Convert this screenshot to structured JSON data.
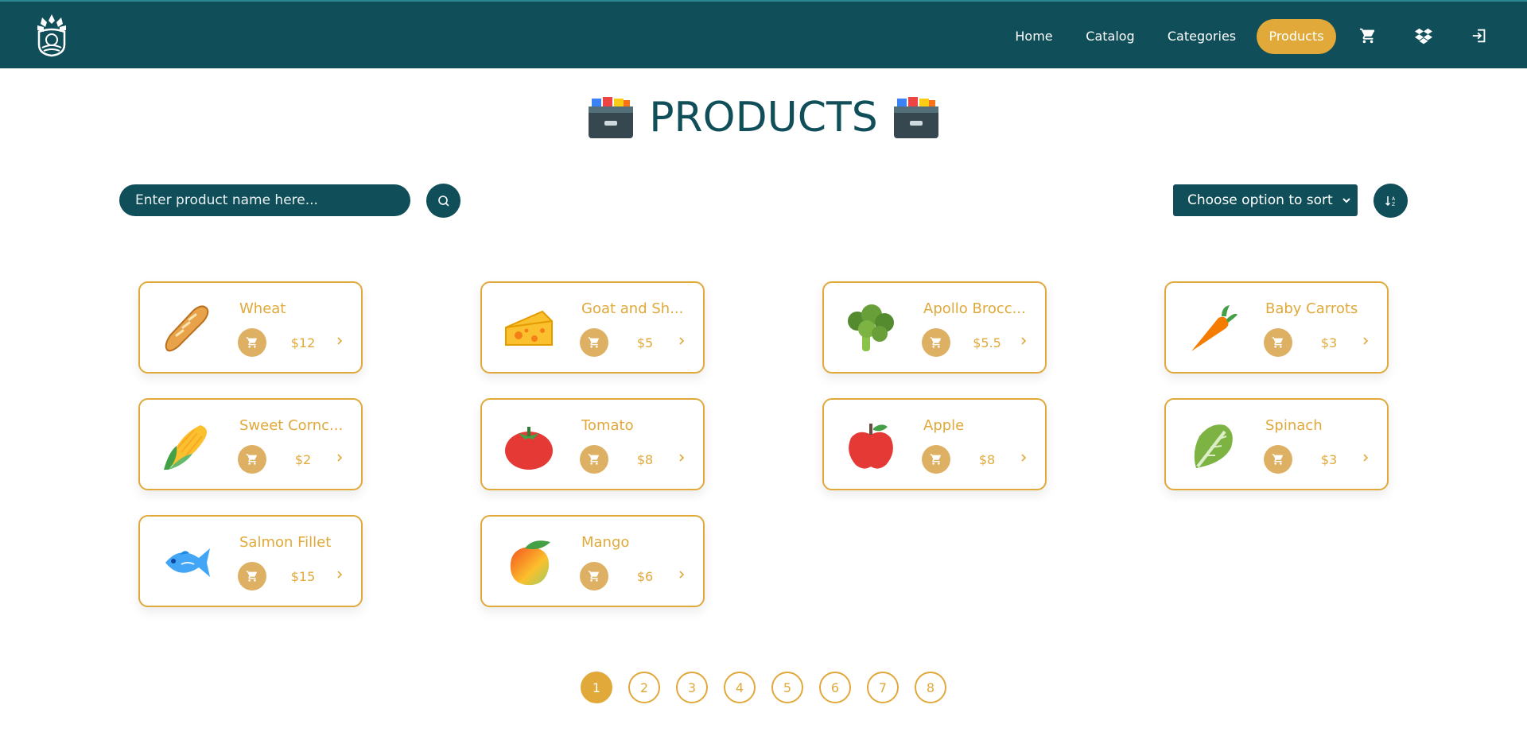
{
  "nav": {
    "logo": "brand-logo",
    "links": [
      {
        "label": "Home"
      },
      {
        "label": "Catalog"
      },
      {
        "label": "Categories"
      },
      {
        "label": "Products",
        "active": true
      }
    ],
    "icons": [
      "cart-icon",
      "dropbox-icon",
      "logout-icon"
    ]
  },
  "page": {
    "title": "PRODUCTS",
    "title_emoji": "card-file-box-icon"
  },
  "search": {
    "placeholder": "Enter product name here...",
    "value": ""
  },
  "sort": {
    "selected": "Choose option to sort"
  },
  "products": [
    {
      "name": "Wheat",
      "price": "$12",
      "icon": "baguette-icon"
    },
    {
      "name": "Goat and Sh...",
      "price": "$5",
      "icon": "cheese-icon"
    },
    {
      "name": "Apollo Brocc...",
      "price": "$5.5",
      "icon": "broccoli-icon"
    },
    {
      "name": "Baby Carrots",
      "price": "$3",
      "icon": "carrot-icon"
    },
    {
      "name": "Sweet Cornc...",
      "price": "$2",
      "icon": "corn-icon"
    },
    {
      "name": "Tomato",
      "price": "$8",
      "icon": "tomato-icon"
    },
    {
      "name": "Apple",
      "price": "$8",
      "icon": "apple-icon"
    },
    {
      "name": "Spinach",
      "price": "$3",
      "icon": "leafy-green-icon"
    },
    {
      "name": "Salmon Fillet",
      "price": "$15",
      "icon": "fish-icon"
    },
    {
      "name": "Mango",
      "price": "$6",
      "icon": "mango-icon"
    }
  ],
  "pagination": {
    "pages": [
      "1",
      "2",
      "3",
      "4",
      "5",
      "6",
      "7",
      "8"
    ],
    "current": "1"
  },
  "colors": {
    "primary": "#104f59",
    "accent": "#e0a93a",
    "cart_button": "#ddb063"
  }
}
